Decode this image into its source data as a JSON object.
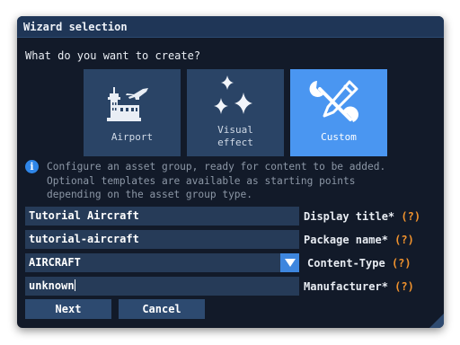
{
  "window": {
    "title": "Wizard selection"
  },
  "prompt": "What do you want to create?",
  "tiles": [
    {
      "label": "Airport",
      "icon": "airport-icon",
      "selected": false
    },
    {
      "label": "Visual\neffect",
      "icon": "sparkles-icon",
      "selected": false
    },
    {
      "label": "Custom",
      "icon": "tools-icon",
      "selected": true
    }
  ],
  "info": {
    "icon": "info-icon",
    "text": "Configure an asset group, ready for content to be added.\nOptional templates are available as starting points\ndepending on the asset group type."
  },
  "fields": {
    "display_title": {
      "value": "Tutorial Aircraft",
      "label": "Display title*",
      "help": "(?)"
    },
    "package_name": {
      "value": "tutorial-aircraft",
      "label": "Package name*",
      "help": "(?)"
    },
    "content_type": {
      "value": "AIRCRAFT",
      "label": "Content-Type",
      "help": "(?)"
    },
    "manufacturer": {
      "value": "unknown",
      "label": "Manufacturer*",
      "help": "(?)"
    }
  },
  "buttons": {
    "next": "Next",
    "cancel": "Cancel"
  },
  "colors": {
    "accent": "#4a96f1",
    "help": "#f0922d",
    "panel": "#121a29",
    "tile": "#2a4466"
  }
}
